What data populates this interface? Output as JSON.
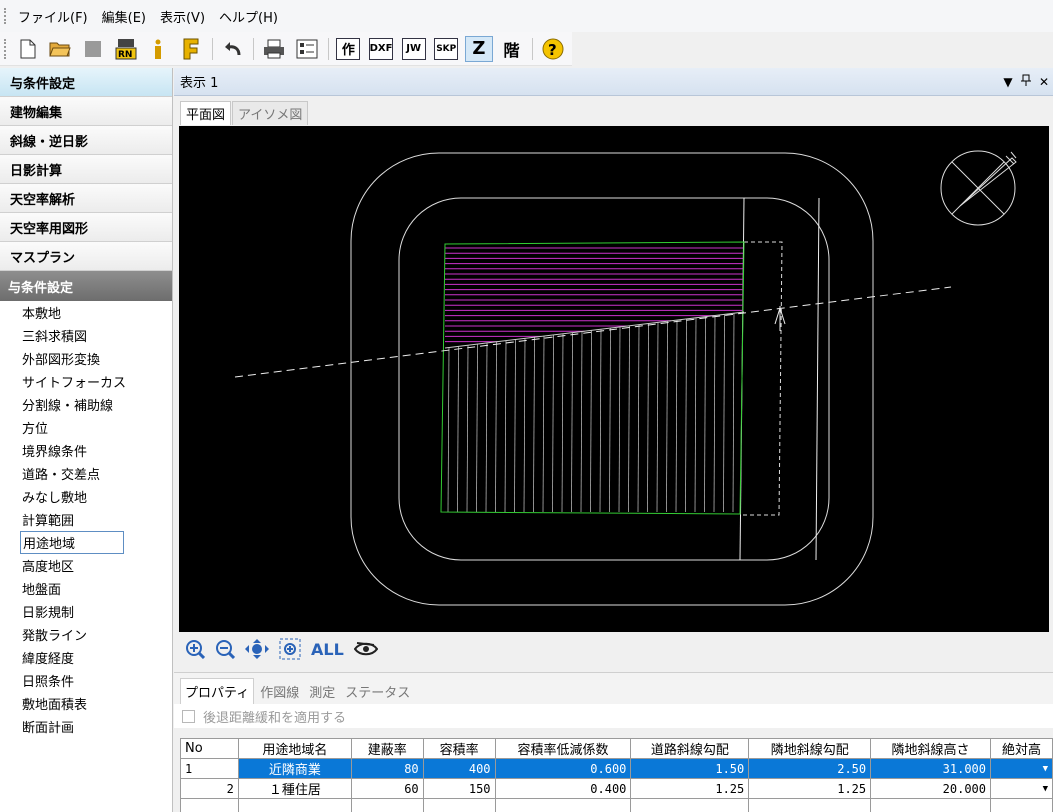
{
  "menubar": {
    "items": [
      "ファイル(F)",
      "編集(E)",
      "表示(V)",
      "ヘルプ(H)"
    ]
  },
  "toolbar": {
    "buttons": [
      "new-file-icon",
      "open-folder-icon",
      "save-icon",
      "rn-icon",
      "info-icon",
      "f-icon",
      "undo-icon",
      "print-icon",
      "list-icon"
    ],
    "tool_labels": {
      "saku": "作",
      "dxf": "DXF",
      "jw": "JW",
      "skp": "SKP",
      "z": "Z",
      "kai": "階",
      "help": "?"
    }
  },
  "left_panel": {
    "categories": [
      "与条件設定",
      "建物編集",
      "斜線・逆日影",
      "日影計算",
      "天空率解析",
      "天空率用図形",
      "マスプラン"
    ],
    "section_header": "与条件設定",
    "items": [
      "本敷地",
      "三斜求積図",
      "外部図形変換",
      "サイトフォーカス",
      "分割線・補助線",
      "方位",
      "境界線条件",
      "道路・交差点",
      "みなし敷地",
      "計算範囲",
      "用途地域",
      "高度地区",
      "地盤面",
      "日影規制",
      "発散ライン",
      "緯度経度",
      "日照条件",
      "敷地面積表",
      "断面計画"
    ],
    "selected_item": "用途地域"
  },
  "document": {
    "title": "表示 1",
    "view_tabs": [
      "平面図",
      "アイソメ図"
    ],
    "zoom_all_label": "ALL"
  },
  "bottom_panel": {
    "tabs": [
      "プロパティ",
      "作図線",
      "測定",
      "ステータス"
    ],
    "checkbox_label": "後退距離緩和を適用する",
    "grid": {
      "headers": [
        "No",
        "用途地域名",
        "建蔽率",
        "容積率",
        "容積率低減係数",
        "道路斜線勾配",
        "隣地斜線勾配",
        "隣地斜線高さ",
        "絶対高"
      ],
      "rows": [
        [
          "1",
          "近隣商業",
          "80",
          "400",
          "0.600",
          "1.50",
          "2.50",
          "31.000",
          ""
        ],
        [
          "2",
          "１種住居",
          "60",
          "150",
          "0.400",
          "1.25",
          "1.25",
          "20.000",
          ""
        ]
      ]
    }
  },
  "colors": {
    "canvas_bg": "#000000",
    "site_outline": "#33cc33",
    "hatch_top": "#cc33cc",
    "selection": "#0a78d7"
  }
}
